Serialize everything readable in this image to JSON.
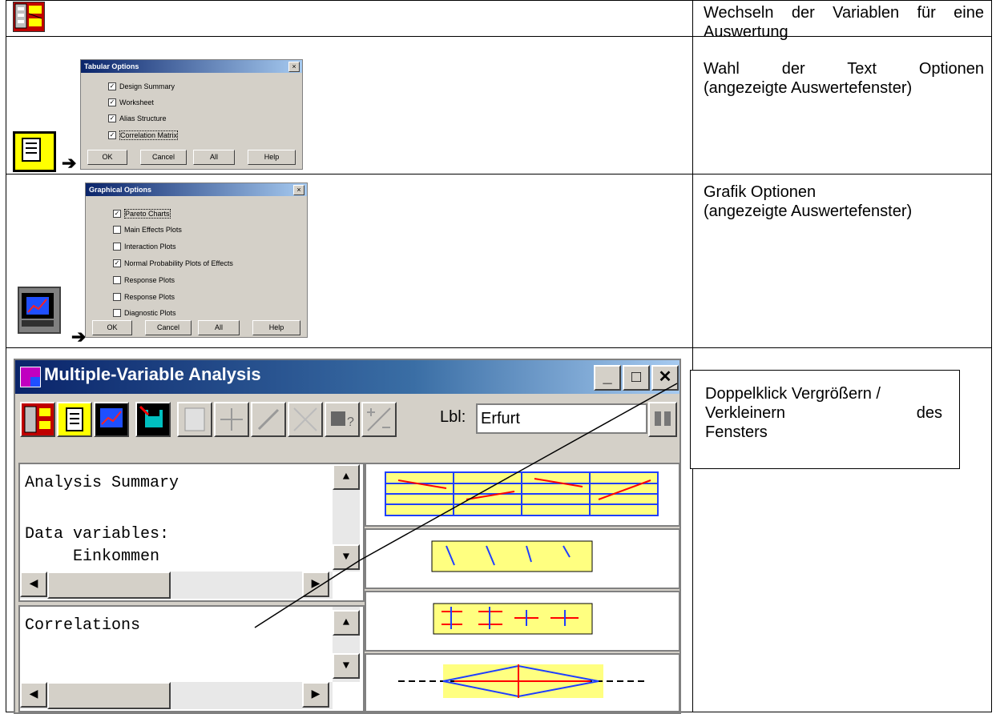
{
  "rows": [
    {
      "description": "Wechseln der Variablen für eine Auswertung"
    },
    {
      "description_line1": "Wahl der Text Optionen",
      "description_line2": "(angezeigte Auswertefenster)",
      "dialog": {
        "title": "Tabular Options",
        "options": [
          {
            "label": "Design Summary",
            "checked": true
          },
          {
            "label": "Worksheet",
            "checked": true
          },
          {
            "label": "Alias Structure",
            "checked": true
          },
          {
            "label": "Correlation Matrix",
            "checked": true
          }
        ],
        "buttons": [
          "OK",
          "Cancel",
          "All",
          "Help"
        ]
      }
    },
    {
      "description_line1": "Grafik Optionen",
      "description_line2": "(angezeigte Auswertefenster)",
      "dialog": {
        "title": "Graphical Options",
        "options": [
          {
            "label": "Pareto Charts",
            "checked": true
          },
          {
            "label": "Main Effects Plots",
            "checked": false
          },
          {
            "label": "Interaction Plots",
            "checked": false
          },
          {
            "label": "Normal Probability Plots of Effects",
            "checked": true
          },
          {
            "label": "Response Plots",
            "checked": false
          },
          {
            "label": "Response Plots",
            "checked": false
          },
          {
            "label": "Diagnostic Plots",
            "checked": false
          }
        ],
        "buttons": [
          "OK",
          "Cancel",
          "All",
          "Help"
        ]
      }
    }
  ],
  "window": {
    "title": "Multiple-Variable Analysis",
    "label_prefix": "Lbl:",
    "label_value": "Erfurt",
    "pane1_lines": [
      "Analysis Summary",
      "",
      "Data variables:",
      "     Einkommen"
    ],
    "pane2_lines": [
      "Correlations"
    ],
    "arrow_symbol": "➔",
    "check_symbol": "✓",
    "minimize": "_",
    "maximize": "□",
    "close": "✕"
  },
  "callout": {
    "line1": "Doppelklick Vergrößern /",
    "line2": "Verkleinern des",
    "line3": "Fensters"
  }
}
